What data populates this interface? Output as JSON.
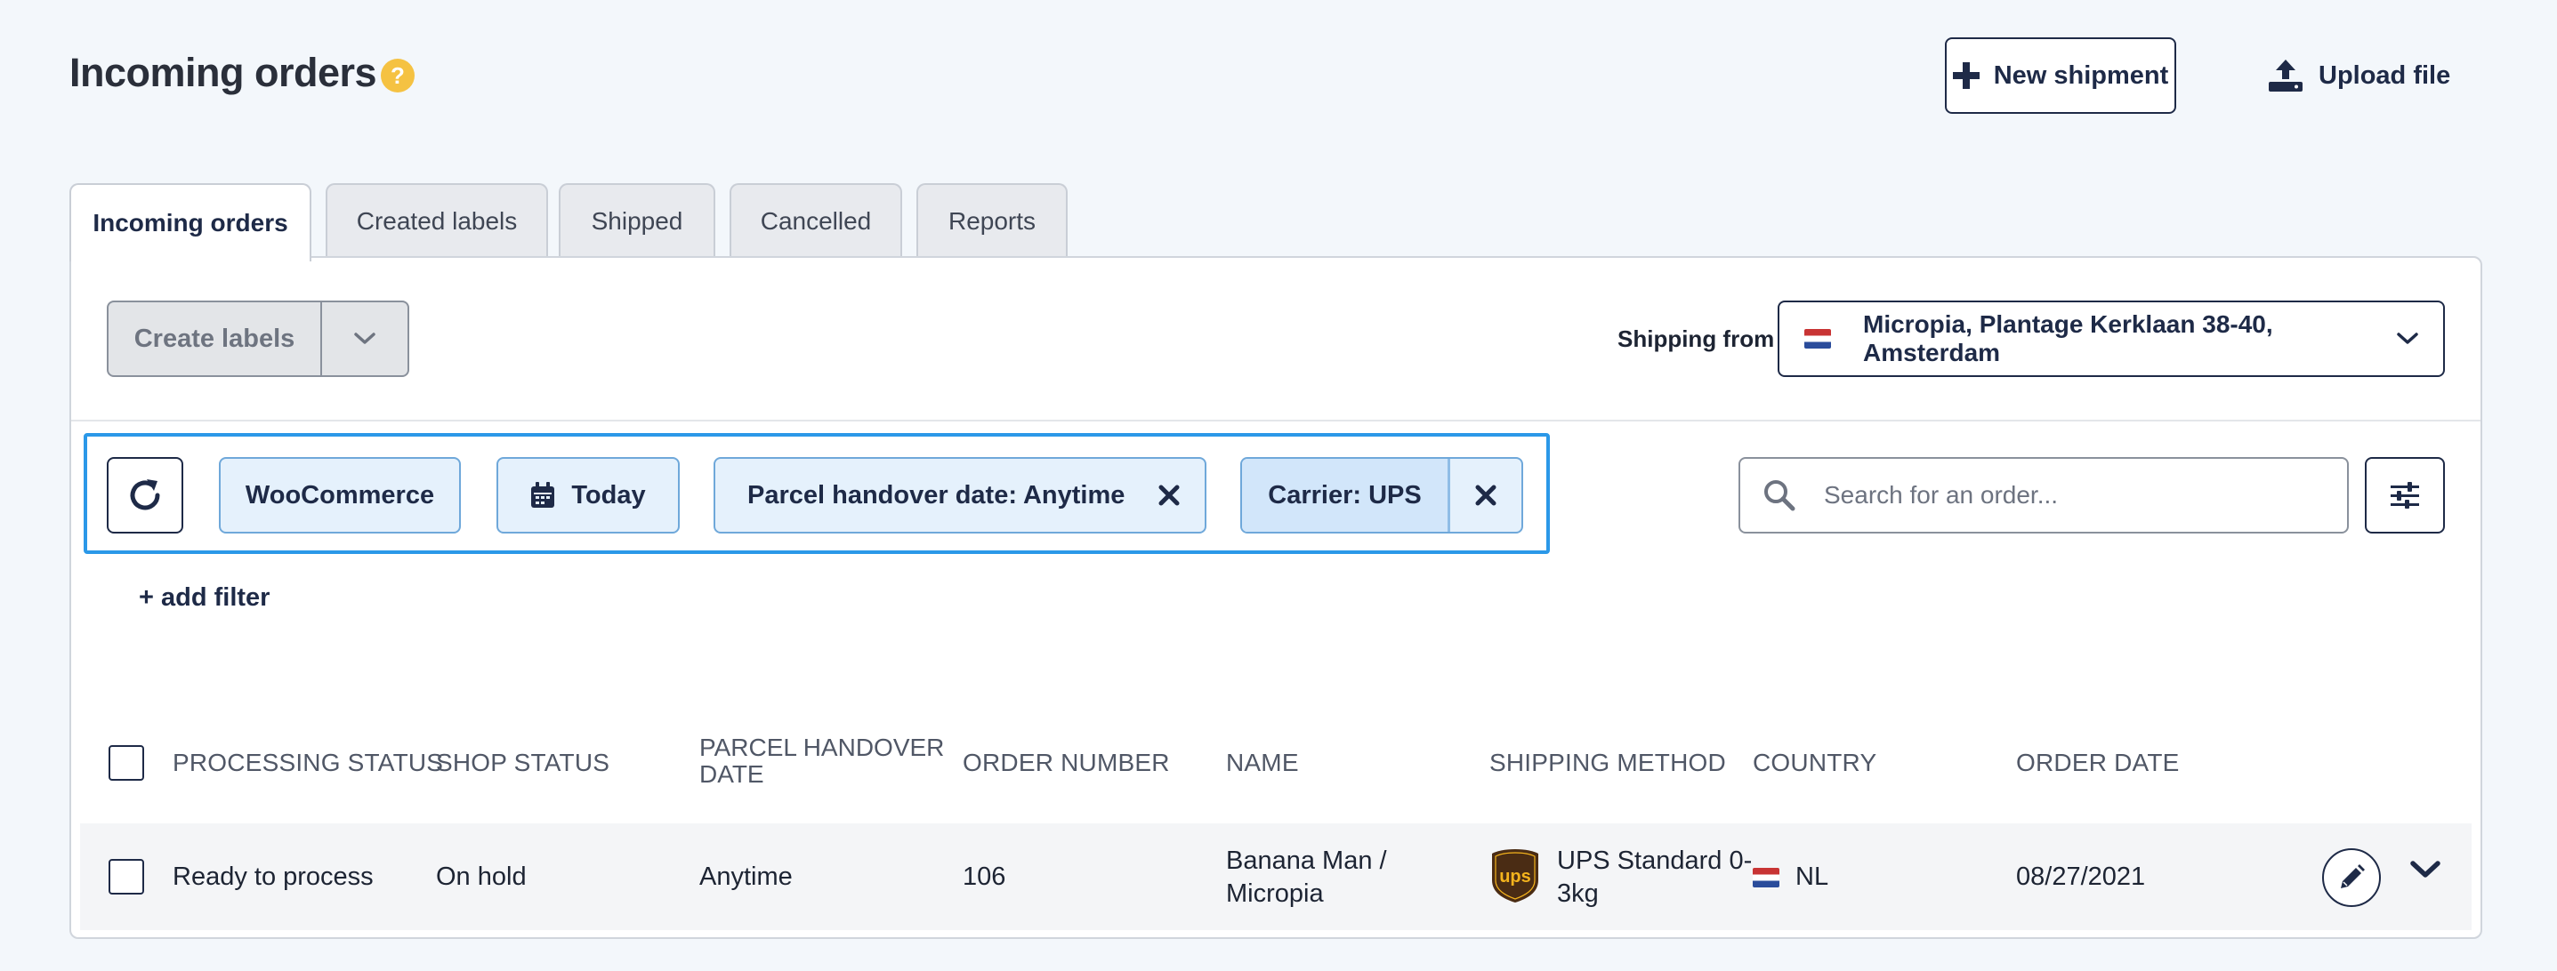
{
  "header": {
    "title": "Incoming orders",
    "help_icon": "question-circle-icon",
    "new_shipment_label": "New shipment",
    "upload_file_label": "Upload file"
  },
  "tabs": [
    {
      "label": "Incoming orders",
      "active": true
    },
    {
      "label": "Created labels",
      "active": false
    },
    {
      "label": "Shipped",
      "active": false
    },
    {
      "label": "Cancelled",
      "active": false
    },
    {
      "label": "Reports",
      "active": false
    }
  ],
  "toolbar": {
    "create_labels": "Create labels",
    "create_labels_disabled": true,
    "shipping_from_label": "Shipping from",
    "shipping_from_value": "Micropia, Plantage Kerklaan 38-40, Amsterdam"
  },
  "filters": {
    "chips": [
      {
        "label": "WooCommerce"
      },
      {
        "label": "Today"
      },
      {
        "label": "Parcel handover date: Anytime"
      },
      {
        "label": "Carrier: UPS"
      }
    ],
    "add_filter": "+ add filter"
  },
  "search": {
    "placeholder": "Search for an order..."
  },
  "table": {
    "headers": {
      "processing_status": "PROCESSING STATUS",
      "shop_status": "SHOP STATUS",
      "parcel_handover_line1": "PARCEL HANDOVER",
      "parcel_handover_line2": "DATE",
      "order_number": "ORDER NUMBER",
      "name": "NAME",
      "shipping_method": "SHIPPING METHOD",
      "country": "COUNTRY",
      "order_date": "ORDER DATE"
    },
    "rows": [
      {
        "processing_status": "Ready to process",
        "shop_status": "On hold",
        "parcel_handover_date": "Anytime",
        "order_number": "106",
        "name_line1": "Banana Man /",
        "name_line2": "Micropia",
        "shipping_method_line1": "UPS Standard 0-",
        "shipping_method_line2": "3kg",
        "country": "NL",
        "order_date": "08/27/2021"
      }
    ]
  },
  "colors": {
    "primary": "#1e2a47",
    "focus_outline": "#2b98e8",
    "chip_bg": "#e5f1fc",
    "help": "#f5c242",
    "ups_brown": "#4a2c14",
    "ups_gold": "#f4b31d"
  }
}
